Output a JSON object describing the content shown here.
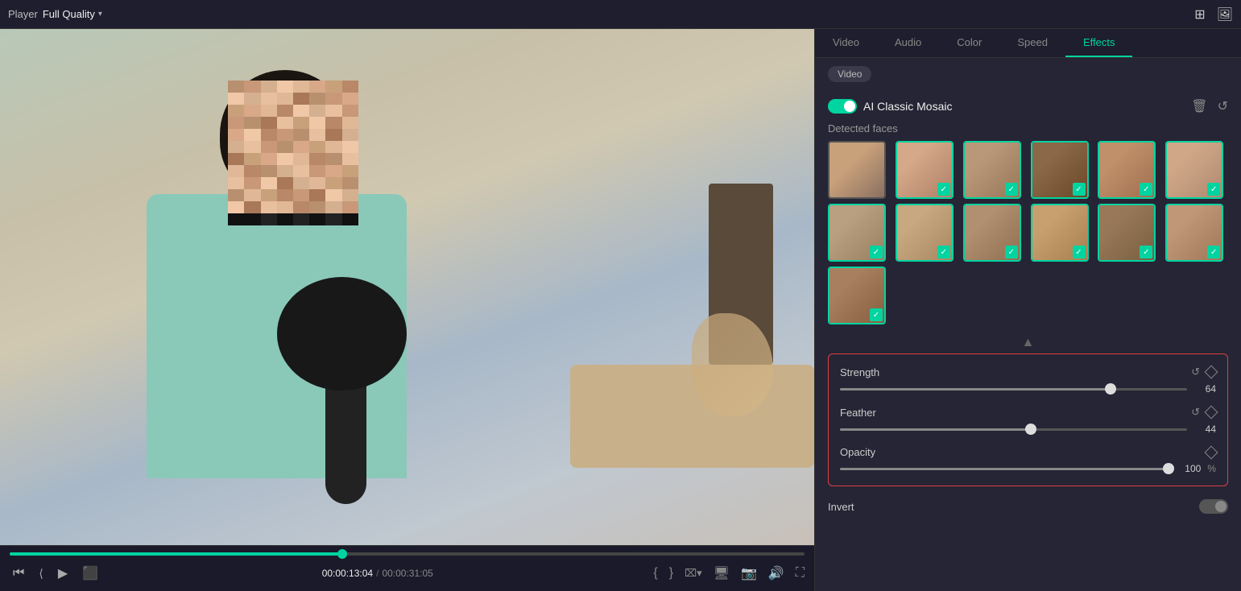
{
  "topbar": {
    "player_label": "Player",
    "quality_label": "Full Quality",
    "grid_icon": "⊞",
    "image_icon": "🖼"
  },
  "tabs": [
    {
      "label": "Video",
      "active": false
    },
    {
      "label": "Audio",
      "active": false
    },
    {
      "label": "Color",
      "active": false
    },
    {
      "label": "Speed",
      "active": false
    },
    {
      "label": "Effects",
      "active": true
    }
  ],
  "effects": {
    "video_badge": "Video",
    "effect_name": "AI Classic Mosaic",
    "detected_faces_label": "Detected faces",
    "faces_count": 13,
    "collapse_icon": "▲",
    "params": {
      "strength_label": "Strength",
      "strength_value": "64",
      "feather_label": "Feather",
      "feather_value": "44",
      "opacity_label": "Opacity",
      "opacity_value": "100",
      "opacity_unit": "%"
    },
    "invert_label": "Invert"
  },
  "timeline": {
    "current_time": "00:00:13:04",
    "total_time": "00:00:31:05",
    "time_divider": "/",
    "progress_pct": 41.8,
    "strength_slider_pct": 78,
    "feather_slider_pct": 55,
    "opacity_slider_pct": 99
  },
  "transport": {
    "rewind_icon": "⏮",
    "step_back_icon": "⏪",
    "play_icon": "▶",
    "stop_icon": "⬛",
    "bracket_open": "{",
    "bracket_close": "}",
    "split_icon": "✂",
    "monitor_icon": "🖥",
    "camera_icon": "📷",
    "volume_icon": "🔊",
    "fullscreen_icon": "⛶"
  }
}
